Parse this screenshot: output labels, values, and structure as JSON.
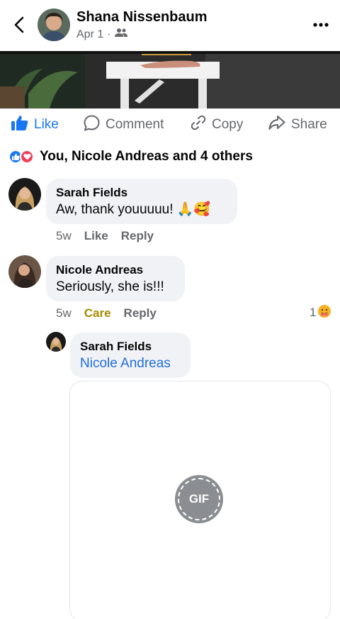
{
  "header": {
    "name": "Shana Nissenbaum",
    "date": "Apr 1",
    "separator": "·",
    "audience_icon": "friends-icon",
    "more_icon": "more-dots-icon",
    "back_icon": "back-chevron-icon"
  },
  "actions": {
    "like": "Like",
    "comment": "Comment",
    "copy": "Copy",
    "share": "Share"
  },
  "reactions": {
    "summary": "You, Nicole Andreas and 4 others",
    "icons": [
      "like-reaction-icon",
      "love-reaction-icon"
    ]
  },
  "comments": [
    {
      "author": "Sarah Fields",
      "text": "Aw, thank youuuuu! 🙏🥰",
      "time": "5w",
      "reaction_label": "Like",
      "reply_label": "Reply"
    },
    {
      "author": "Nicole Andreas",
      "text": "Seriously, she is!!!",
      "time": "5w",
      "reaction_label": "Care",
      "reply_label": "Reply",
      "reaction_count": "1"
    }
  ],
  "reply": {
    "author": "Sarah Fields",
    "mention": "Nicole Andreas",
    "gif_label": "GIF"
  },
  "colors": {
    "accent": "#1877f2",
    "care": "#a68a00",
    "mention": "#216fdb",
    "secondary_text": "#65676b",
    "bubble": "#f0f2f5"
  }
}
